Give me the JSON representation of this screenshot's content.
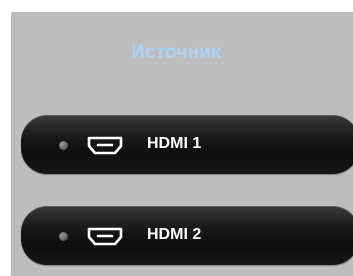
{
  "menu": {
    "title": "Источник",
    "items": [
      {
        "label": "HDMI 1",
        "icon": "hdmi-port-icon",
        "status": "inactive"
      },
      {
        "label": "HDMI 2",
        "icon": "hdmi-port-icon",
        "status": "inactive"
      }
    ]
  },
  "colors": {
    "panel_background": "#bdbdbd",
    "title": "#a9d3f7",
    "button": "#121212",
    "label": "#ffffff",
    "indicator": "#7a7a7a"
  }
}
